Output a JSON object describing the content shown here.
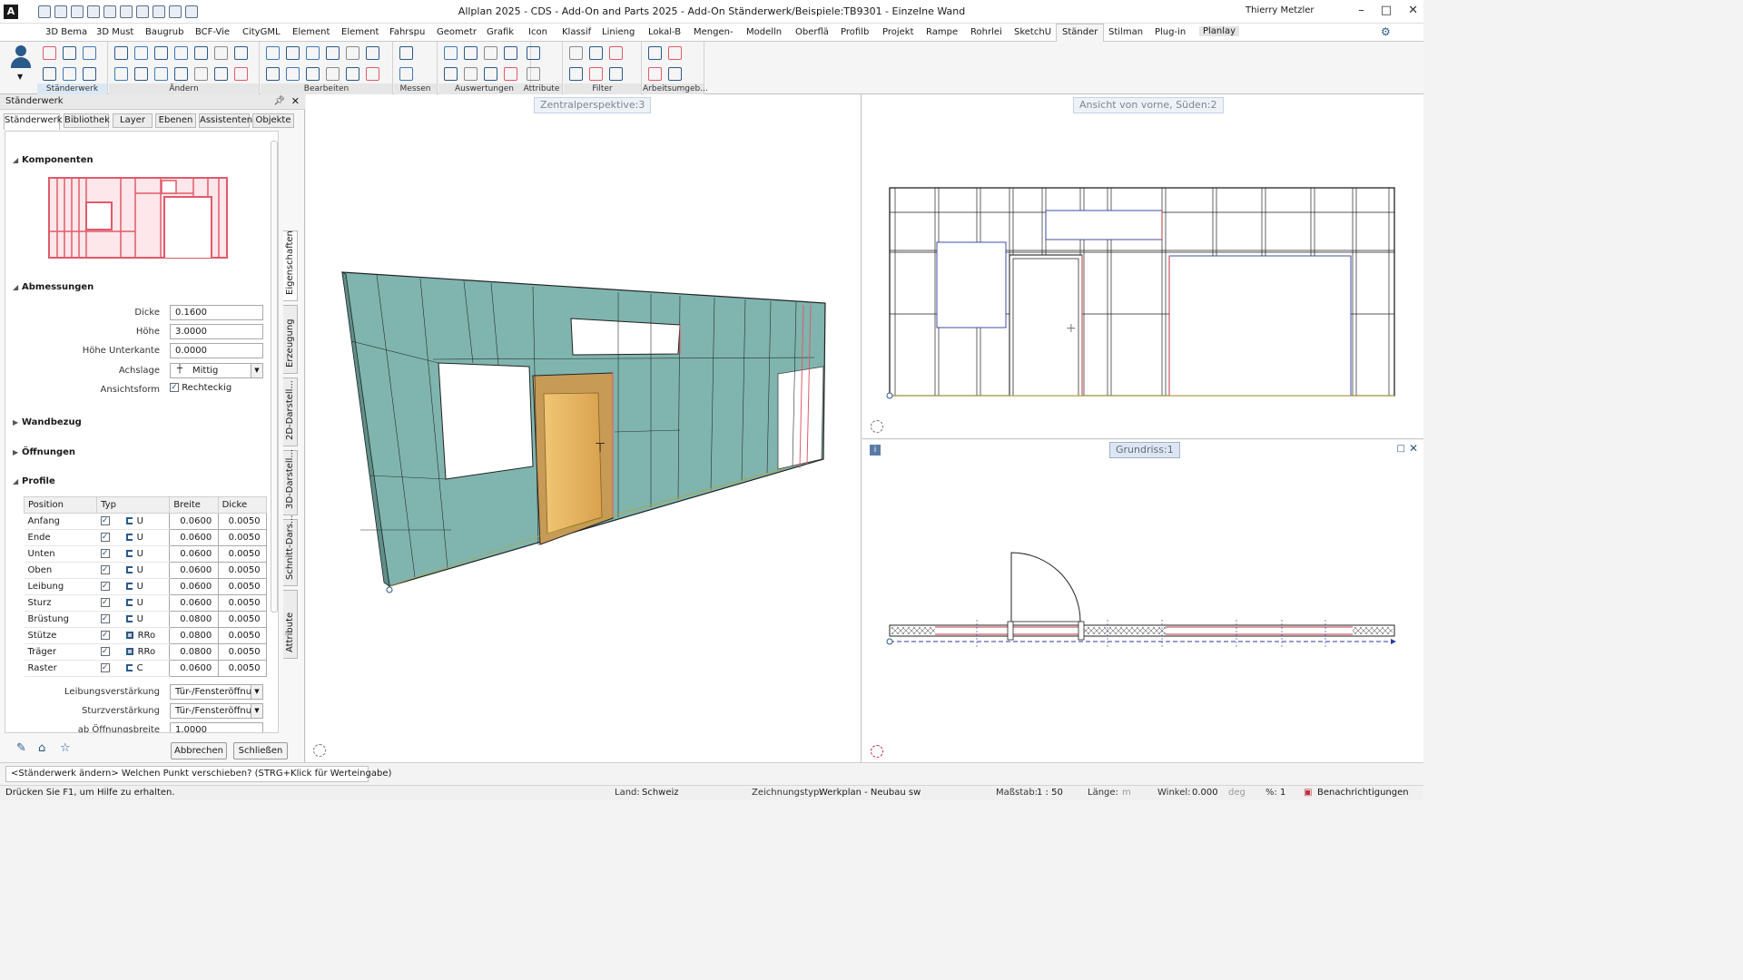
{
  "window": {
    "title": "Allplan 2025 - CDS - Add-On and Parts 2025 - Add-On Ständerwerk/Beispiele:TB9301 - Einzelne Wand",
    "logo": "A",
    "user": "Thierry Metzler"
  },
  "menu_tabs": [
    "3D Bema",
    "3D Must",
    "Baugrub",
    "BCF-Vie",
    "CityGML",
    "Element",
    "Element",
    "Fahrspu",
    "Geometr",
    "Grafik",
    "Icon",
    "Klassif",
    "Linieng",
    "Lokal-B",
    "Mengen-",
    "Modelln",
    "Oberflä",
    "Profilb",
    "Projekt",
    "Rampe",
    "Rohrlei",
    "SketchU",
    "Ständer",
    "Stilman",
    "Plug-in",
    "Planlay"
  ],
  "active_tab": "Ständer",
  "ribbon_groups": [
    "Ständerwerk",
    "Ändern",
    "Bearbeiten",
    "Messen",
    "Auswertungen",
    "Attribute",
    "Filter",
    "Arbeitsumgeb..."
  ],
  "panel": {
    "title": "Ständerwerk",
    "tabs": [
      "Ständerwerk",
      "Bibliothek",
      "Layer",
      "Ebenen",
      "Assistenten",
      "Objekte"
    ],
    "side_tabs": [
      "Eigenschaften",
      "Erzeugung",
      "2D-Darstell...",
      "3D-Darstell...",
      "Schnitt-Dars...",
      "Attribute"
    ],
    "sections": {
      "komponenten": "Komponenten",
      "abmessungen": "Abmessungen",
      "wandbezug": "Wandbezug",
      "oeffnungen": "Öffnungen",
      "profile": "Profile"
    },
    "fields": {
      "dicke_label": "Dicke",
      "dicke": "0.1600",
      "hoehe_label": "Höhe",
      "hoehe": "3.0000",
      "hoehe_unterkante_label": "Höhe Unterkante",
      "hoehe_unterkante": "0.0000",
      "achslage_label": "Achslage",
      "achslage": "Mittig",
      "ansichtsform_label": "Ansichtsform",
      "ansichtsform": "Rechteckig"
    },
    "profile_table": {
      "headers": [
        "Position",
        "Typ",
        "Breite",
        "Dicke"
      ],
      "rows": [
        {
          "position": "Anfang",
          "typ": "U",
          "breite": "0.0600",
          "dicke": "0.0050"
        },
        {
          "position": "Ende",
          "typ": "U",
          "breite": "0.0600",
          "dicke": "0.0050"
        },
        {
          "position": "Unten",
          "typ": "U",
          "breite": "0.0600",
          "dicke": "0.0050"
        },
        {
          "position": "Oben",
          "typ": "U",
          "breite": "0.0600",
          "dicke": "0.0050"
        },
        {
          "position": "Leibung",
          "typ": "U",
          "breite": "0.0600",
          "dicke": "0.0050"
        },
        {
          "position": "Sturz",
          "typ": "U",
          "breite": "0.0600",
          "dicke": "0.0050"
        },
        {
          "position": "Brüstung",
          "typ": "U",
          "breite": "0.0800",
          "dicke": "0.0050"
        },
        {
          "position": "Stütze",
          "typ": "RRo",
          "breite": "0.0800",
          "dicke": "0.0050"
        },
        {
          "position": "Träger",
          "typ": "RRo",
          "breite": "0.0800",
          "dicke": "0.0050"
        },
        {
          "position": "Raster",
          "typ": "C",
          "breite": "0.0600",
          "dicke": "0.0050"
        }
      ]
    },
    "extra": {
      "leibung_label": "Leibungsverstärkung",
      "leibung": "Tür-/Fensteröffnur",
      "sturz_label": "Sturzverstärkung",
      "sturz": "Tür-/Fensteröffnur",
      "ab_label": "ab Öffnungsbreite",
      "ab": "1.0000"
    },
    "buttons": {
      "cancel": "Abbrechen",
      "close": "Schließen"
    }
  },
  "viewports": {
    "perspective": "Zentralperspektive:3",
    "front": "Ansicht von vorne, Süden:2",
    "plan": "Grundriss:1"
  },
  "command_prompt": "<Ständerwerk ändern> Welchen Punkt verschieben? (STRG+Klick für Werteingabe)",
  "status": {
    "help": "Drücken Sie F1, um Hilfe zu erhalten.",
    "land_label": "Land:",
    "land": "Schweiz",
    "ztyp_label": "Zeichnungstyp:",
    "ztyp": "Werkplan - Neubau sw",
    "massstab_label": "Maßstab:",
    "massstab": "1 : 50",
    "laenge_label": "Länge:",
    "laenge_unit": "m",
    "winkel_label": "Winkel:",
    "winkel": "0.000",
    "winkel_unit": "deg",
    "prozent_label": "%:",
    "prozent": "1",
    "notifications": "Benachrichtigungen"
  },
  "colors": {
    "wall": "#7fb5ae",
    "frame": "#e05a6a",
    "door": "#e7b86a",
    "accent": "#2a5a8a"
  }
}
